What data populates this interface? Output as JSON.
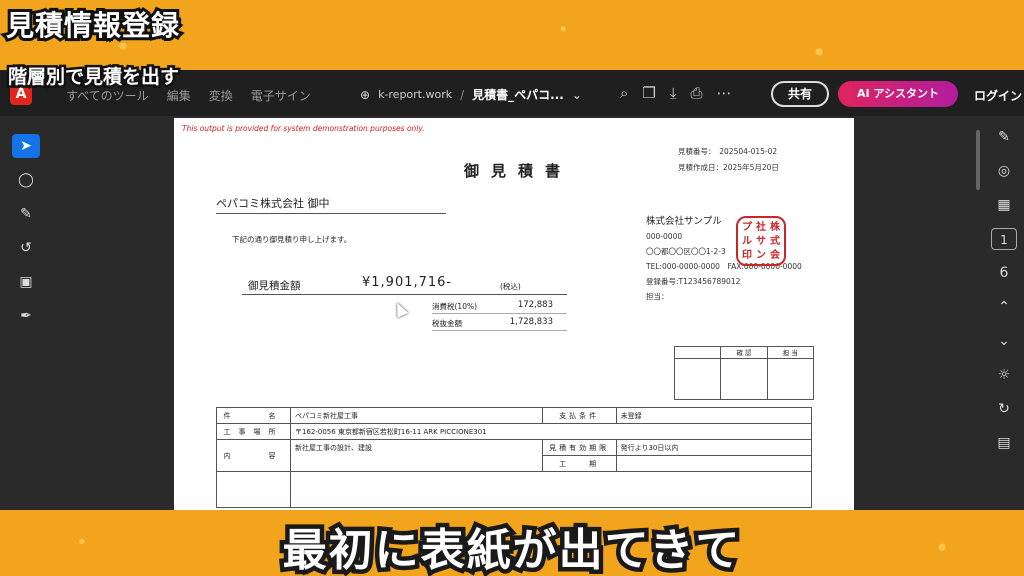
{
  "overlay": {
    "title": "見積情報登録",
    "subheading": "階層別で見積を出す",
    "subtitle": "最初に表紙が出てきて"
  },
  "toolbar": {
    "logo": "A",
    "menu": [
      "すべてのツール",
      "編集",
      "変換",
      "電子サイン"
    ],
    "site": "k-report.work",
    "separator": "/",
    "file_name": "見積書_ペパコ...",
    "share_label": "共有",
    "ai_label": "AI アシスタント",
    "login_label": "ログイン"
  },
  "left_tools": [
    "select-icon",
    "comment-icon",
    "draw-icon",
    "lasso-icon",
    "text-box-icon",
    "sign-icon"
  ],
  "right_tools": {
    "page_current": "1",
    "page_total": "6"
  },
  "document": {
    "disclaimer": "This output is provided for system demonstration purposes only.",
    "estimate_no_label": "見積番号：",
    "estimate_no": "202504-015-02",
    "created_label": "見積作成日：",
    "created_date": "2025年5月20日",
    "title": "御見積書",
    "client": "ペパコミ株式会社  御中",
    "greeting": "下記の通り御見積り申し上げます。",
    "company_name": "株式会社サンプル",
    "postal": "000-0000",
    "address": "〇〇都〇〇区〇〇1-2-3",
    "tel": "TEL:000-0000-0000",
    "fax": "FAX:000-0000-0000",
    "registration": "登録番号:T123456789012",
    "person": "担当：",
    "seal": [
      "株",
      "式",
      "会",
      "社",
      "サ",
      "ン",
      "プ",
      "ル",
      "印"
    ],
    "total_label": "御見積金額",
    "total_amount": "¥1,901,716-",
    "tax_included": "(税込)",
    "tax_label": "消費税(10%)",
    "tax_amount": "172,883",
    "pretax_label": "税抜金額",
    "pretax_amount": "1,728,833",
    "approval_headers": [
      "",
      "確 認",
      "担 当"
    ],
    "rows": {
      "item_label": "件　　名",
      "item_value": "ペパコミ新社屋工事",
      "payment_label": "支払条件",
      "payment_value": "未登録",
      "site_label": "工事場所",
      "site_value": "〒162-0056 東京都新宿区若松町16-11 ARK PICCIONE301",
      "content_label": "内　　容",
      "content_value": "新社屋工事の設計、建設",
      "validity_label": "見積有効期限",
      "validity_value": "発行より30日以内",
      "period_label": "工　　期",
      "period_value": ""
    }
  }
}
